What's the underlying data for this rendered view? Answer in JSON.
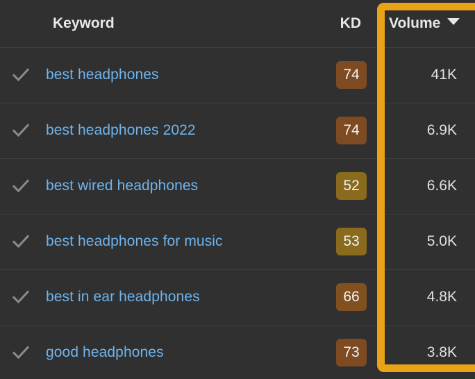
{
  "table": {
    "columns": [
      {
        "id": "checkbox",
        "label": ""
      },
      {
        "id": "keyword",
        "label": "Keyword"
      },
      {
        "id": "kd",
        "label": "KD"
      },
      {
        "id": "volume",
        "label": "Volume"
      }
    ],
    "sort": {
      "column": "Volume",
      "direction": "descending",
      "icon": "caret-down-icon"
    },
    "row_icon": "check-icon",
    "rows": [
      {
        "keyword": "best headphones",
        "kd": "74",
        "kd_color": "#7d4a22",
        "volume": "41K"
      },
      {
        "keyword": "best headphones 2022",
        "kd": "74",
        "kd_color": "#7d4a22",
        "volume": "6.9K"
      },
      {
        "keyword": "best wired headphones",
        "kd": "52",
        "kd_color": "#8a6a1c",
        "volume": "6.6K"
      },
      {
        "keyword": "best headphones for music",
        "kd": "53",
        "kd_color": "#8a6a1c",
        "volume": "5.0K"
      },
      {
        "keyword": "best in ear headphones",
        "kd": "66",
        "kd_color": "#80511f",
        "volume": "4.8K"
      },
      {
        "keyword": "good headphones",
        "kd": "73",
        "kd_color": "#7d4a22",
        "volume": "3.8K"
      }
    ]
  },
  "annotation": {
    "highlight_box": {
      "name": "volume-column-highlight",
      "color": "#e8a317",
      "target_column": "Volume"
    }
  },
  "colors": {
    "background": "#303030",
    "row_divider": "#3e3e3e",
    "link": "#6eb4ef",
    "header_text": "#e8e8e8",
    "value_text": "#e0e0e0",
    "check_icon": "#8c8c8c",
    "highlight": "#e8a317"
  }
}
